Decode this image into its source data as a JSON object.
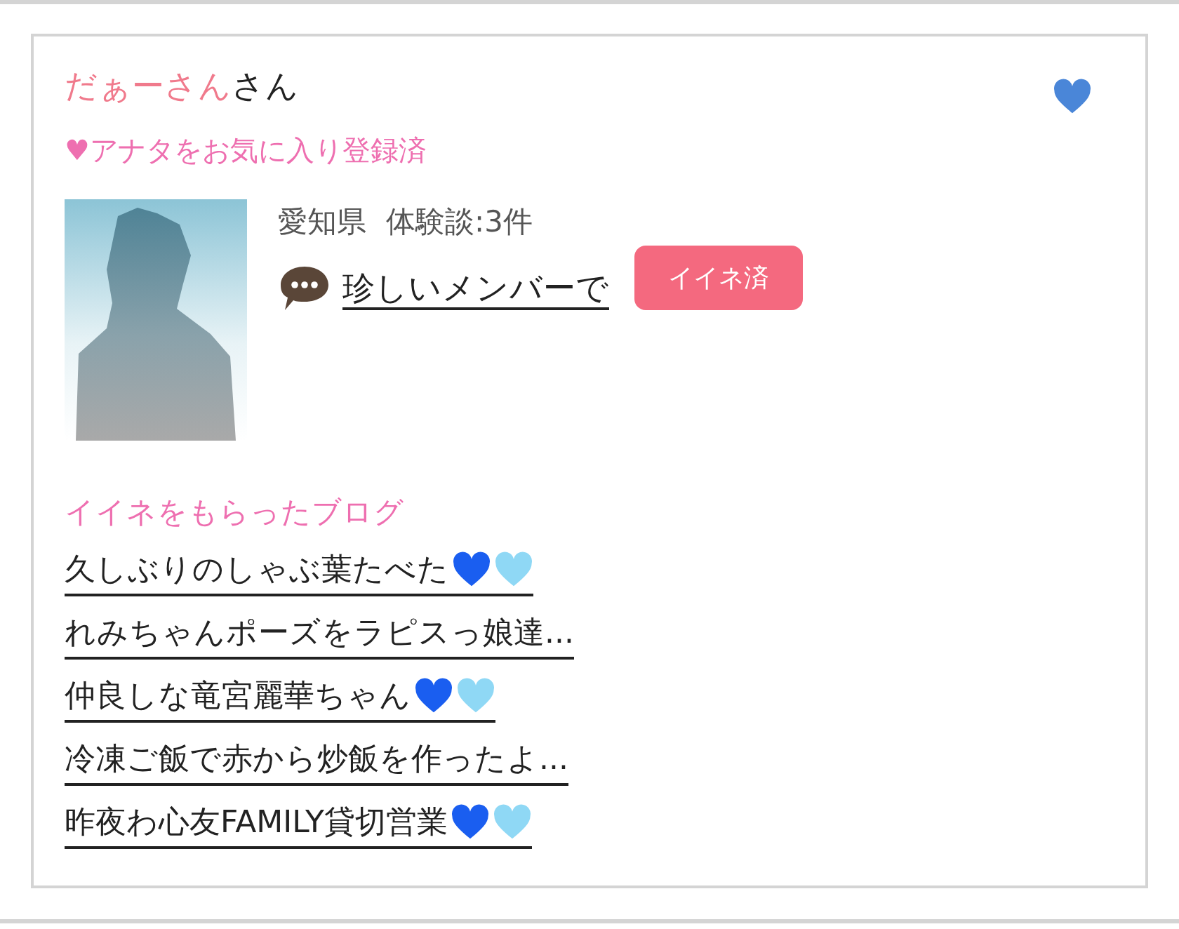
{
  "profile": {
    "name": "だぁーさん",
    "suffix": "さん",
    "favorite": true,
    "favorite_note": "♥アナタをお気に入り登録済",
    "location": "愛知県",
    "reviews": "体験談:3件",
    "comment": "珍しいメンバーで",
    "like_button": {
      "label": "イイネ済",
      "liked": true
    }
  },
  "blogs": {
    "heading": "イイネをもらったブログ",
    "items": [
      {
        "title": "久しぶりのしゃぶ葉たべた",
        "hearts": [
          {
            "color": "#1a5ef0"
          },
          {
            "color": "#8fd8f5"
          }
        ]
      },
      {
        "title": "れみちゃんポーズをラピスっ娘達..."
      },
      {
        "title": "仲良しな竜宮麗華ちゃん",
        "hearts": [
          {
            "color": "#1a5ef0"
          },
          {
            "color": "#8fd8f5"
          }
        ]
      },
      {
        "title": "冷凍ご飯で赤から炒飯を作ったよ..."
      },
      {
        "title": "昨夜わ心友FAMILY貸切営業",
        "hearts": [
          {
            "color": "#1a5ef0"
          },
          {
            "color": "#8fd8f5"
          }
        ]
      }
    ]
  }
}
